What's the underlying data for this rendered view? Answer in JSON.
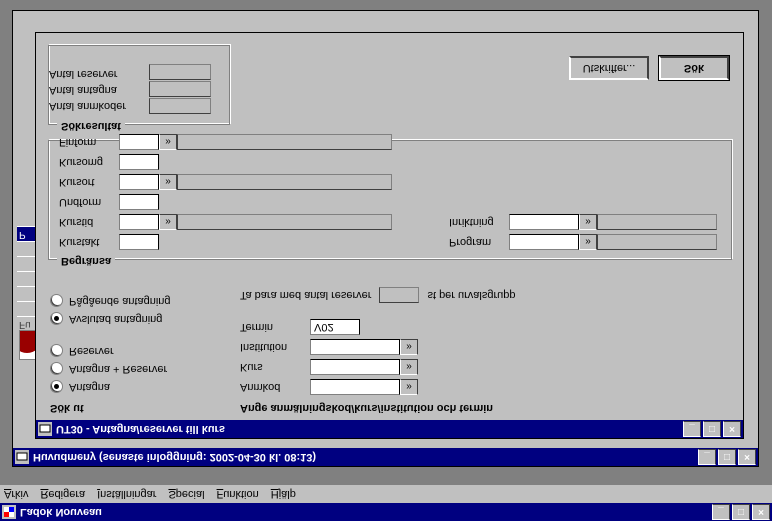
{
  "app_title": "Ladok Nouveau",
  "menu": {
    "arkiv": "Arkiv",
    "redigera": "Redigera",
    "installningar": "Inställningar",
    "special": "Special",
    "funktion": "Funktion",
    "hjalp": "Hjälp"
  },
  "main_window": {
    "title": "Huvudmeny   (senaste inloggning:  2002-04-30 kl. 08:13)"
  },
  "side_tabs": [
    "Fu",
    "",
    "",
    "",
    "",
    "",
    "P"
  ],
  "inner": {
    "title": "UT30 - Antagna/reserver till kurs",
    "left": {
      "sok_ut": "Sök ut",
      "opt_antagna": "Antagna",
      "opt_ant_res": "Antagna + Reserver",
      "opt_res": "Reserver",
      "opt_avslutad": "Avslutad antagning",
      "opt_pagaende": "Pågående antagning"
    },
    "right": {
      "header": "Ange anmälningskod/kurs/institution och termin",
      "anmkod": "Anmkod",
      "kurs": "Kurs",
      "institution": "Institution",
      "termin": "Termin",
      "termin_value": "V02",
      "tabara": "Ta bara med antal reserver",
      "tabara_suffix": "st per urvalsgrupp"
    },
    "begransa": {
      "legend": "Begränsa",
      "kurstakt": "Kurstakt",
      "kurstid": "Kurstid",
      "undform": "Undform",
      "kursort": "Kursort",
      "kursomg": "Kursomg",
      "finform": "Finform",
      "program": "Program",
      "inriktning": "Inriktning"
    },
    "sokresultat": {
      "legend": "Sökresultat",
      "antal_anmkoder": "Antal anmkoder",
      "antal_antagna": "Antal antagna",
      "antal_reserver": "Antal reserver"
    },
    "buttons": {
      "sok": "Sök",
      "utskrifter": "Utskrifter..."
    }
  }
}
